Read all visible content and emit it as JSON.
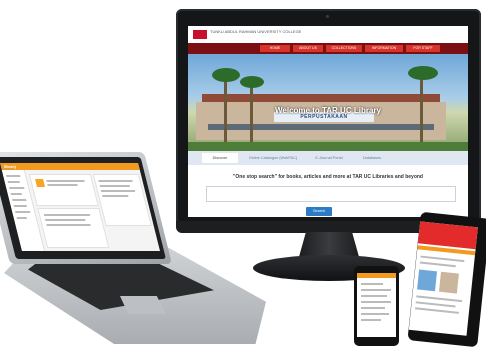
{
  "desktop": {
    "logo_text": "TAR UC",
    "header_text": "TUNKU ABDUL RAHMAN UNIVERSITY COLLEGE",
    "nav_items": [
      "HOME",
      "ABOUT US",
      "COLLECTIONS",
      "INFORMATION",
      "FOR STAFF"
    ],
    "welcome": "Welcome to TAR UC Library",
    "building_sign": "PERPUSTAKAAN",
    "tabs": [
      "Discover",
      "Online Catalogue (WebPAC)",
      "E-Journal Portal",
      "Databases"
    ],
    "search_prompt": "\"One stop search\" for books, articles and more at TAR UC Libraries and beyond",
    "search_placeholder": "",
    "search_button": "Search"
  },
  "laptop": {
    "title": "library"
  },
  "colors": {
    "accent_orange": "#f29a1f",
    "nav_red": "#7c0f12",
    "button_blue": "#2b7cc4",
    "tablet_red": "#e32b2b"
  }
}
